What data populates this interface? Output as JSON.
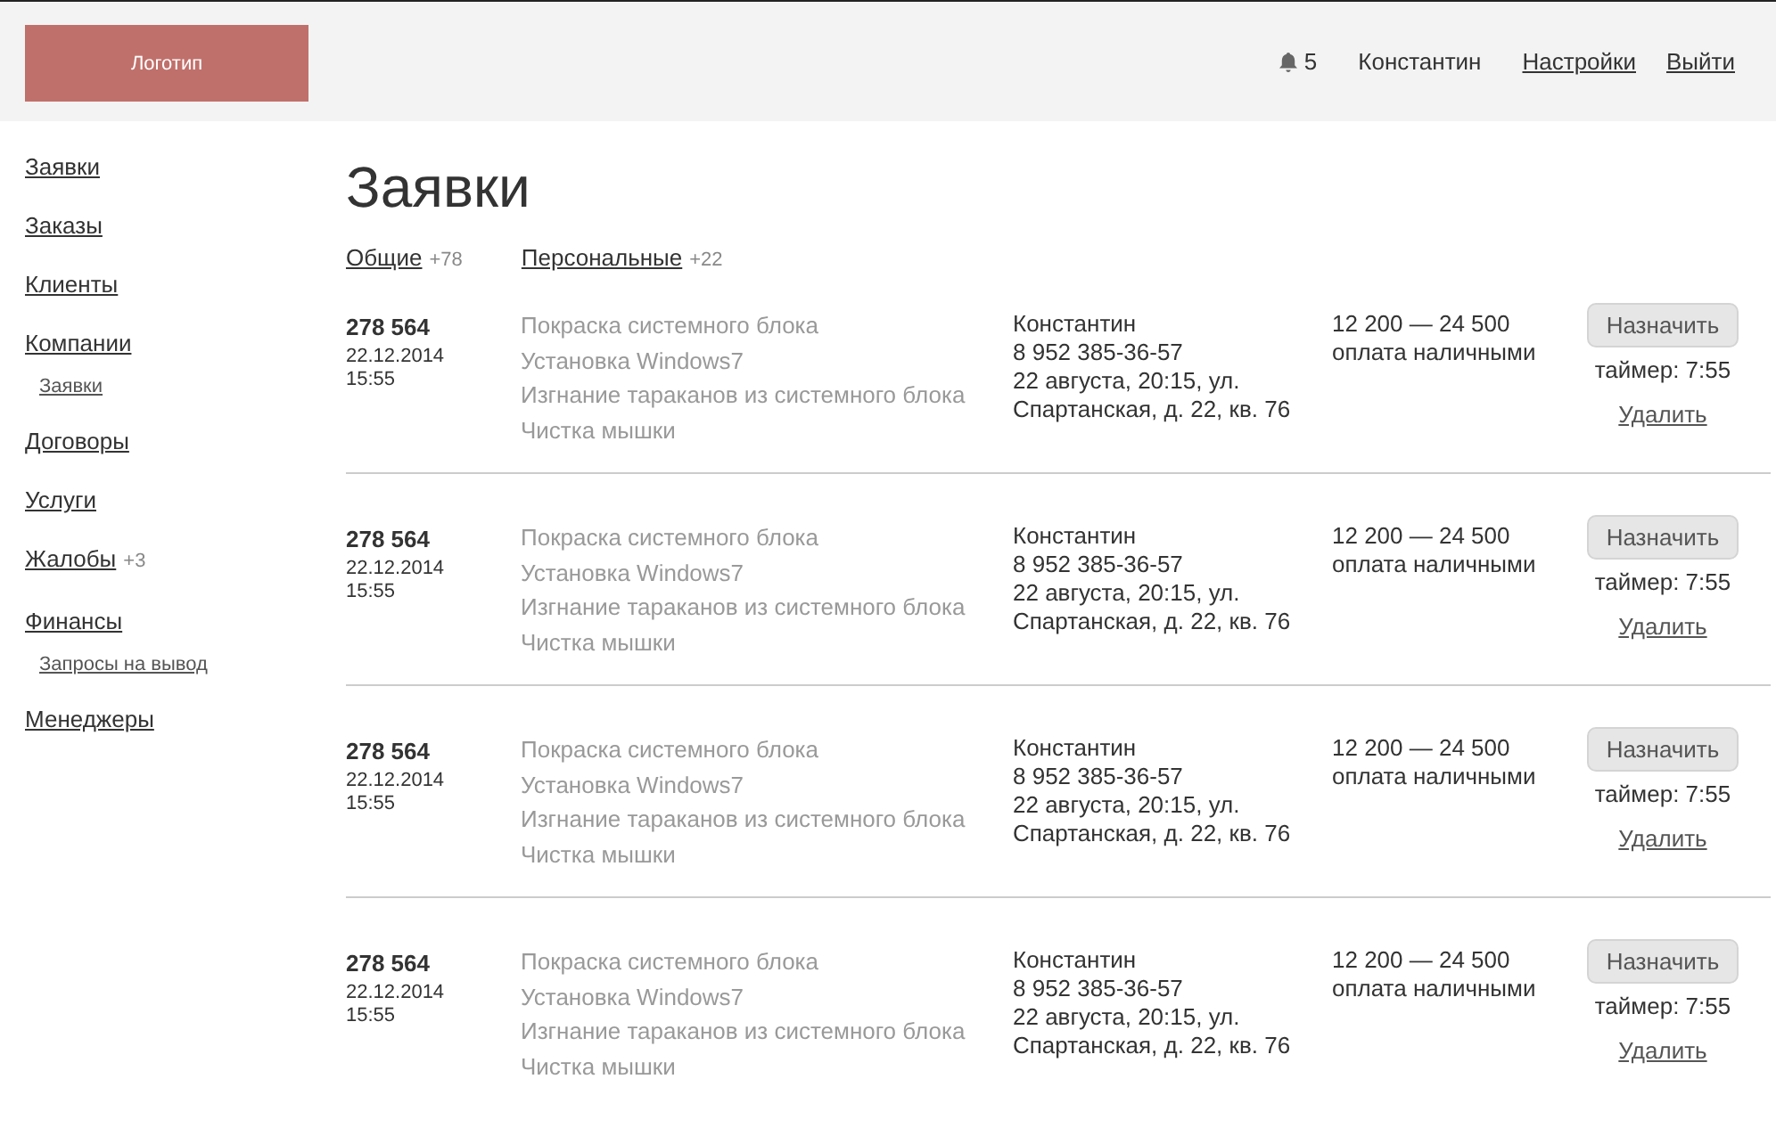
{
  "header": {
    "logo": "Логотип",
    "notifications": "5",
    "user": "Константин",
    "links": [
      "Настройки",
      "Выйти"
    ]
  },
  "sidebar": {
    "items": [
      {
        "label": "Заявки"
      },
      {
        "label": "Заказы"
      },
      {
        "label": "Клиенты"
      },
      {
        "label": "Компании",
        "children": [
          {
            "label": "Заявки"
          }
        ]
      },
      {
        "label": "Договоры"
      },
      {
        "label": "Услуги"
      },
      {
        "label": "Жалобы",
        "count": "+3"
      },
      {
        "label": "Финансы",
        "children": [
          {
            "label": "Запросы на вывод"
          }
        ]
      },
      {
        "label": "Менеджеры"
      }
    ]
  },
  "page": {
    "title": "Заявки"
  },
  "tabs": [
    {
      "label": "Общие",
      "count": "+78"
    },
    {
      "label": "Персональные",
      "count": "+22"
    }
  ],
  "orders": [
    {
      "number": "278 564",
      "date": "22.12.2014",
      "time": "15:55",
      "services": [
        "Покраска системного блока",
        "Установка Windows7",
        "Изгнание тараканов из системного блока",
        "Чистка мышки"
      ],
      "client": "Константин",
      "phone": "8 952 385-36-57",
      "address": [
        "22 августа, 20:15, ул.",
        "Спартанская, д. 22, кв. 76"
      ],
      "price": "12 200 — 24 500",
      "payment": "оплата наличными",
      "assign": "Назначить",
      "timer": "таймер: 7:55",
      "delete": "Удалить"
    },
    {
      "number": "278 564",
      "date": "22.12.2014",
      "time": "15:55",
      "services": [
        "Покраска системного блока",
        "Установка Windows7",
        "Изгнание тараканов из системного блока",
        "Чистка мышки"
      ],
      "client": "Константин",
      "phone": "8 952 385-36-57",
      "address": [
        "22 августа, 20:15, ул.",
        "Спартанская, д. 22, кв. 76"
      ],
      "price": "12 200 — 24 500",
      "payment": "оплата наличными",
      "assign": "Назначить",
      "timer": "таймер: 7:55",
      "delete": "Удалить"
    },
    {
      "number": "278 564",
      "date": "22.12.2014",
      "time": "15:55",
      "services": [
        "Покраска системного блока",
        "Установка Windows7",
        "Изгнание тараканов из системного блока",
        "Чистка мышки"
      ],
      "client": "Константин",
      "phone": "8 952 385-36-57",
      "address": [
        "22 августа, 20:15, ул.",
        "Спартанская, д. 22, кв. 76"
      ],
      "price": "12 200 — 24 500",
      "payment": "оплата наличными",
      "assign": "Назначить",
      "timer": "таймер: 7:55",
      "delete": "Удалить"
    },
    {
      "number": "278 564",
      "date": "22.12.2014",
      "time": "15:55",
      "services": [
        "Покраска системного блока",
        "Установка Windows7",
        "Изгнание тараканов из системного блока",
        "Чистка мышки"
      ],
      "client": "Константин",
      "phone": "8 952 385-36-57",
      "address": [
        "22 августа, 20:15, ул.",
        "Спартанская, д. 22, кв. 76"
      ],
      "price": "12 200 — 24 500",
      "payment": "оплата наличными",
      "assign": "Назначить",
      "timer": "таймер: 7:55",
      "delete": "Удалить"
    }
  ]
}
